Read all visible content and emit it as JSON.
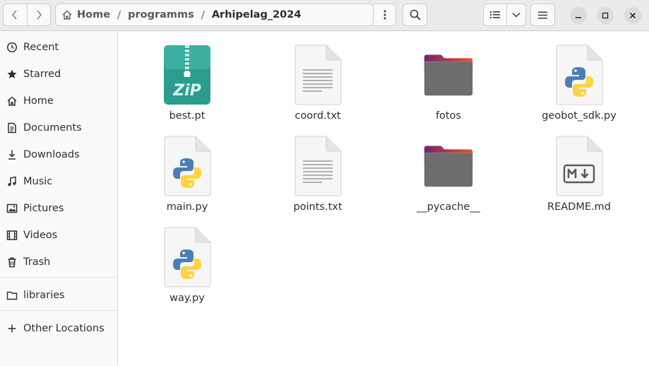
{
  "breadcrumb": {
    "items": [
      "Home",
      "programms",
      "Arhipelag_2024"
    ]
  },
  "sidebar": {
    "items": [
      {
        "label": "Recent",
        "icon": "clock-icon"
      },
      {
        "label": "Starred",
        "icon": "star-icon"
      },
      {
        "label": "Home",
        "icon": "home-icon"
      },
      {
        "label": "Documents",
        "icon": "document-icon"
      },
      {
        "label": "Downloads",
        "icon": "download-icon"
      },
      {
        "label": "Music",
        "icon": "music-icon"
      },
      {
        "label": "Pictures",
        "icon": "picture-icon"
      },
      {
        "label": "Videos",
        "icon": "video-icon"
      },
      {
        "label": "Trash",
        "icon": "trash-icon"
      },
      {
        "label": "libraries",
        "icon": "folder-icon"
      },
      {
        "label": "Other Locations",
        "icon": "plus-icon"
      }
    ]
  },
  "files": [
    {
      "name": "best.pt",
      "kind": "zip",
      "badge": "ZiP"
    },
    {
      "name": "coord.txt",
      "kind": "text"
    },
    {
      "name": "fotos",
      "kind": "folder"
    },
    {
      "name": "geobot_sdk.py",
      "kind": "python"
    },
    {
      "name": "main.py",
      "kind": "python"
    },
    {
      "name": "points.txt",
      "kind": "text"
    },
    {
      "name": "__pycache__",
      "kind": "folder"
    },
    {
      "name": "README.md",
      "kind": "markdown"
    },
    {
      "name": "way.py",
      "kind": "python"
    }
  ],
  "colors": {
    "folder_top": "#e95420",
    "folder_top_alt": "#77216f",
    "folder_body": "#6d6d6d",
    "zip_teal": "#2a9d8f",
    "python_blue": "#4a7fb5",
    "python_yellow": "#ffd343"
  }
}
